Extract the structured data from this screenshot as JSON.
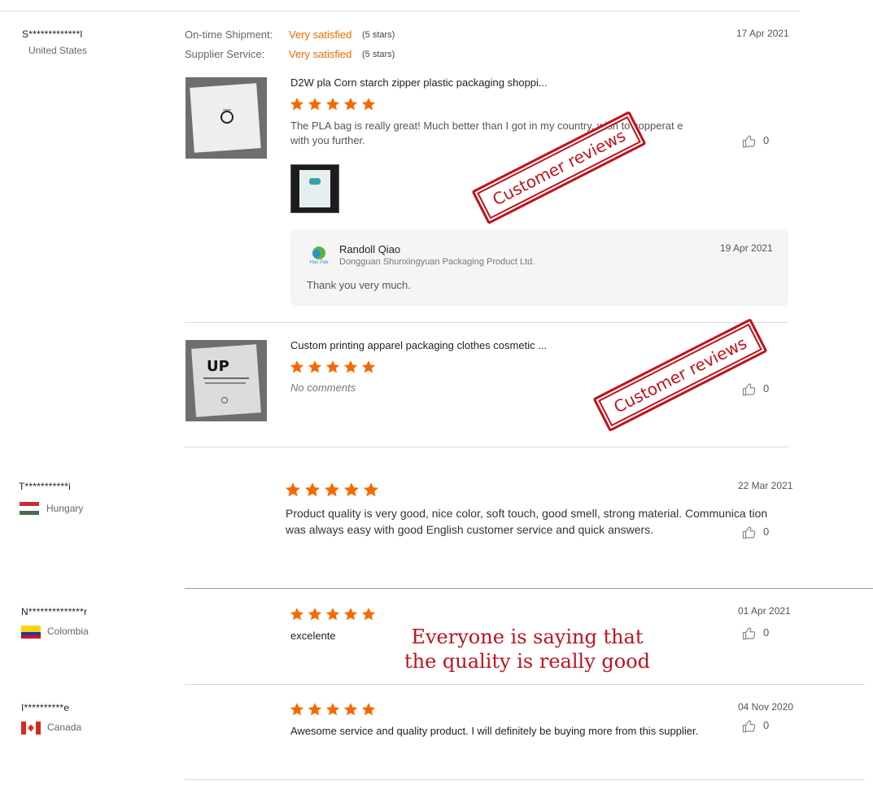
{
  "colors": {
    "accent": "#f56a00",
    "stamp": "#c0121d"
  },
  "reviews": [
    {
      "user": "S*************l",
      "country": "United States",
      "date": "17 Apr 2021",
      "ratings": [
        {
          "label": "On-time Shipment:",
          "value": "Very satisfied",
          "stars": "(5 stars)"
        },
        {
          "label": "Supplier Service:",
          "value": "Very satisfied",
          "stars": "(5 stars)"
        }
      ],
      "products": [
        {
          "title": "D2W pla Corn starch zipper plastic packaging shoppi...",
          "rating": 5,
          "comment": "The PLA bag is really great! Much better than I got in my country, wish to copperat e with you further.",
          "likes": "0",
          "stamp": "Customer reviews",
          "reply": {
            "name": "Randoll Qiao",
            "company": "Dongguan Shunxingyuan Packaging Product Ltd.",
            "logo_text": "Hon Pak",
            "date": "19 Apr 2021",
            "text": "Thank you very much."
          }
        },
        {
          "title": "Custom printing apparel packaging clothes cosmetic ...",
          "rating": 5,
          "comment": "No comments",
          "likes": "0",
          "stamp": "Customer reviews",
          "thumb_logo": "UP"
        }
      ]
    },
    {
      "user": "T***********i",
      "country": "Hungary",
      "date": "22 Mar 2021",
      "rating": 5,
      "comment": "Product quality is very good, nice color, soft touch, good smell, strong material. Communica tion was always easy with good English customer service and quick answers.",
      "likes": "0"
    },
    {
      "user": "N**************r",
      "country": "Colombia",
      "date": "01 Apr 2021",
      "rating": 5,
      "comment": "excelente",
      "likes": "0"
    },
    {
      "user": "I**********e",
      "country": "Canada",
      "date": "04 Nov 2020",
      "rating": 5,
      "comment": "Awesome service and quality product. I will definitely be buying more from this supplier.",
      "likes": "0"
    }
  ],
  "overlay_text": {
    "line1": "Everyone is saying that",
    "line2": "the quality is really good"
  }
}
